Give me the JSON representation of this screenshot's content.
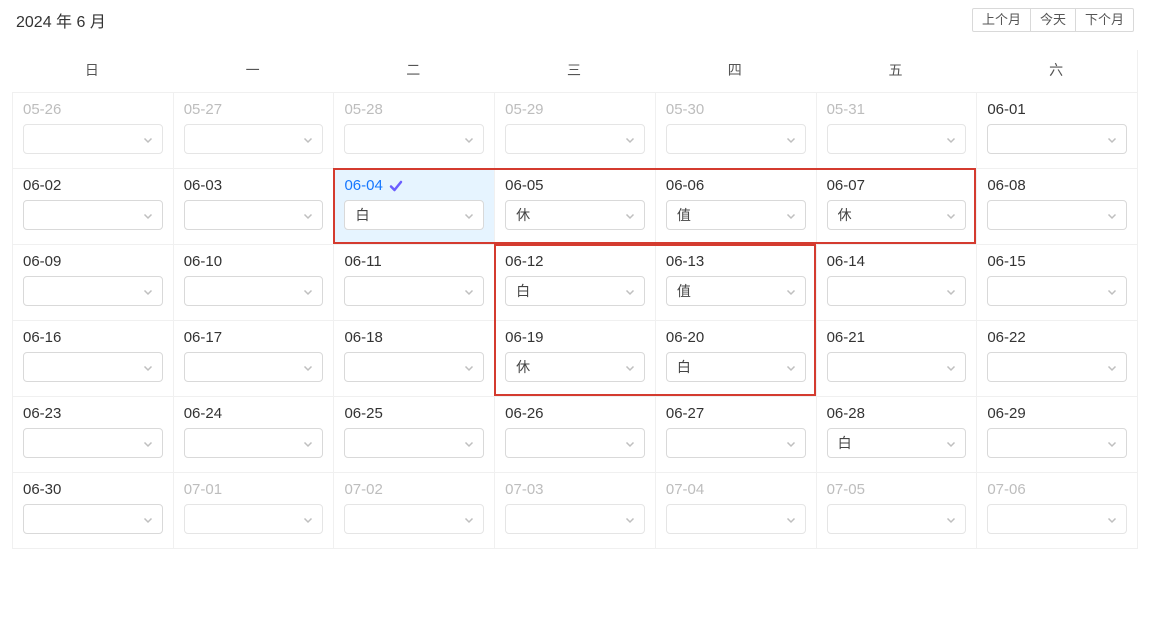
{
  "header": {
    "title": "2024 年 6 月"
  },
  "nav": {
    "prev": "上个月",
    "today": "今天",
    "next": "下个月"
  },
  "dow": [
    "日",
    "一",
    "二",
    "三",
    "四",
    "五",
    "六"
  ],
  "grid": [
    [
      {
        "label": "05-26",
        "value": "",
        "overflow": true,
        "today": false
      },
      {
        "label": "05-27",
        "value": "",
        "overflow": true,
        "today": false
      },
      {
        "label": "05-28",
        "value": "",
        "overflow": true,
        "today": false
      },
      {
        "label": "05-29",
        "value": "",
        "overflow": true,
        "today": false
      },
      {
        "label": "05-30",
        "value": "",
        "overflow": true,
        "today": false
      },
      {
        "label": "05-31",
        "value": "",
        "overflow": true,
        "today": false
      },
      {
        "label": "06-01",
        "value": "",
        "overflow": false,
        "today": false
      }
    ],
    [
      {
        "label": "06-02",
        "value": "",
        "overflow": false,
        "today": false
      },
      {
        "label": "06-03",
        "value": "",
        "overflow": false,
        "today": false
      },
      {
        "label": "06-04",
        "value": "白",
        "overflow": false,
        "today": true
      },
      {
        "label": "06-05",
        "value": "休",
        "overflow": false,
        "today": false
      },
      {
        "label": "06-06",
        "value": "值",
        "overflow": false,
        "today": false
      },
      {
        "label": "06-07",
        "value": "休",
        "overflow": false,
        "today": false
      },
      {
        "label": "06-08",
        "value": "",
        "overflow": false,
        "today": false
      }
    ],
    [
      {
        "label": "06-09",
        "value": "",
        "overflow": false,
        "today": false
      },
      {
        "label": "06-10",
        "value": "",
        "overflow": false,
        "today": false
      },
      {
        "label": "06-11",
        "value": "",
        "overflow": false,
        "today": false
      },
      {
        "label": "06-12",
        "value": "白",
        "overflow": false,
        "today": false
      },
      {
        "label": "06-13",
        "value": "值",
        "overflow": false,
        "today": false
      },
      {
        "label": "06-14",
        "value": "",
        "overflow": false,
        "today": false
      },
      {
        "label": "06-15",
        "value": "",
        "overflow": false,
        "today": false
      }
    ],
    [
      {
        "label": "06-16",
        "value": "",
        "overflow": false,
        "today": false
      },
      {
        "label": "06-17",
        "value": "",
        "overflow": false,
        "today": false
      },
      {
        "label": "06-18",
        "value": "",
        "overflow": false,
        "today": false
      },
      {
        "label": "06-19",
        "value": "休",
        "overflow": false,
        "today": false
      },
      {
        "label": "06-20",
        "value": "白",
        "overflow": false,
        "today": false
      },
      {
        "label": "06-21",
        "value": "",
        "overflow": false,
        "today": false
      },
      {
        "label": "06-22",
        "value": "",
        "overflow": false,
        "today": false
      }
    ],
    [
      {
        "label": "06-23",
        "value": "",
        "overflow": false,
        "today": false
      },
      {
        "label": "06-24",
        "value": "",
        "overflow": false,
        "today": false
      },
      {
        "label": "06-25",
        "value": "",
        "overflow": false,
        "today": false
      },
      {
        "label": "06-26",
        "value": "",
        "overflow": false,
        "today": false
      },
      {
        "label": "06-27",
        "value": "",
        "overflow": false,
        "today": false
      },
      {
        "label": "06-28",
        "value": "白",
        "overflow": false,
        "today": false
      },
      {
        "label": "06-29",
        "value": "",
        "overflow": false,
        "today": false
      }
    ],
    [
      {
        "label": "06-30",
        "value": "",
        "overflow": false,
        "today": false
      },
      {
        "label": "07-01",
        "value": "",
        "overflow": true,
        "today": false
      },
      {
        "label": "07-02",
        "value": "",
        "overflow": true,
        "today": false
      },
      {
        "label": "07-03",
        "value": "",
        "overflow": true,
        "today": false
      },
      {
        "label": "07-04",
        "value": "",
        "overflow": true,
        "today": false
      },
      {
        "label": "07-05",
        "value": "",
        "overflow": true,
        "today": false
      },
      {
        "label": "07-06",
        "value": "",
        "overflow": true,
        "today": false
      }
    ]
  ],
  "highlights": [
    {
      "row_start": 1,
      "row_end": 2,
      "col_start": 2,
      "col_end": 6
    },
    {
      "row_start": 2,
      "row_end": 4,
      "col_start": 3,
      "col_end": 5
    }
  ]
}
